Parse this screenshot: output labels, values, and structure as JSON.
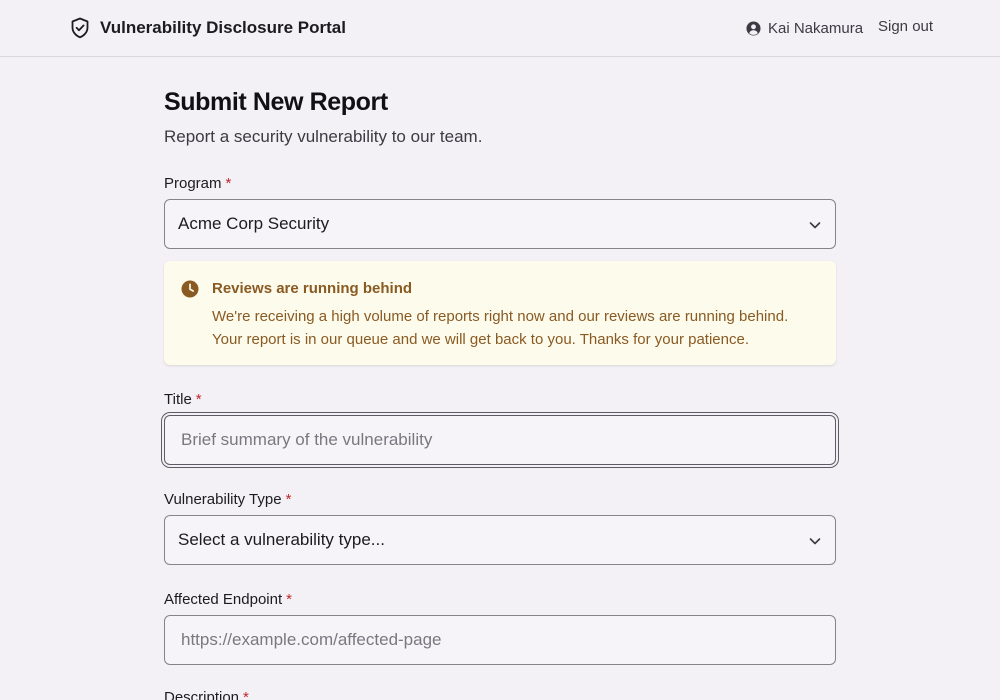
{
  "header": {
    "title": "Vulnerability Disclosure Portal",
    "user_name": "Kai Nakamura",
    "sign_out": "Sign out"
  },
  "page": {
    "title": "Submit New Report",
    "subtitle": "Report a security vulnerability to our team."
  },
  "form": {
    "required_marker": "*",
    "program": {
      "label": "Program",
      "value": "Acme Corp Security"
    },
    "notice": {
      "title": "Reviews are running behind",
      "body_line1": "We're receiving a high volume of reports right now and our reviews are running behind.",
      "body_line2": "Your report is in our queue and we will get back to you. Thanks for your patience."
    },
    "title_field": {
      "label": "Title",
      "placeholder": "Brief summary of the vulnerability"
    },
    "vuln_type": {
      "label": "Vulnerability Type",
      "value": "Select a vulnerability type..."
    },
    "endpoint": {
      "label": "Affected Endpoint",
      "placeholder": "https://example.com/affected-page"
    },
    "description": {
      "label": "Description"
    }
  },
  "icons": {
    "brand": "shield-check-icon",
    "user": "user-circle-icon",
    "dropdown": "chevron-down-icon",
    "notice": "clock-icon"
  },
  "colors": {
    "background": "#f3f1f5",
    "required": "#c0272d",
    "notice_bg": "#fcfbec",
    "notice_text": "#8a5a23"
  }
}
